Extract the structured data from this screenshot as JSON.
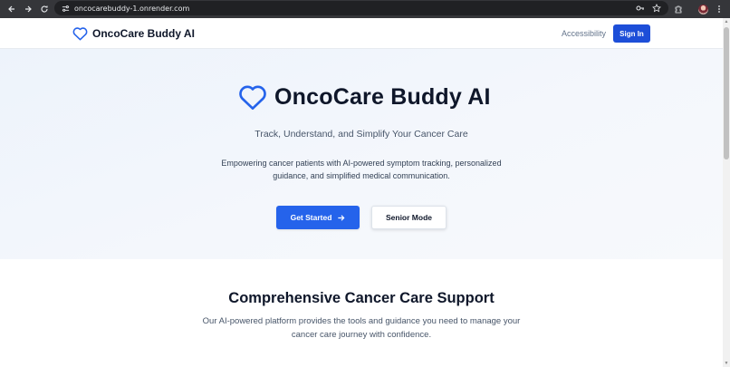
{
  "browser": {
    "url": "oncocarebuddy-1.onrender.com"
  },
  "header": {
    "brand": "OncoCare Buddy AI",
    "accessibility_link": "Accessibility",
    "signin_label": "Sign In"
  },
  "hero": {
    "title": "OncoCare Buddy AI",
    "subtitle": "Track, Understand, and Simplify Your Cancer Care",
    "description": "Empowering cancer patients with AI-powered symptom tracking, personalized guidance, and simplified medical communication.",
    "primary_button": "Get Started",
    "secondary_button": "Senior Mode"
  },
  "features": {
    "title": "Comprehensive Cancer Care Support",
    "description": "Our AI-powered platform provides the tools and guidance you need to manage your cancer care journey with confidence."
  },
  "colors": {
    "accent": "#2563eb",
    "signin": "#1d4ed8",
    "heart_icon": "#2563eb"
  },
  "icons": [
    "back-icon",
    "forward-icon",
    "reload-icon",
    "site-settings-icon",
    "password-key-icon",
    "bookmark-star-icon",
    "extensions-icon",
    "profile-avatar",
    "menu-dots-icon",
    "heart-icon",
    "arrow-right-icon"
  ]
}
